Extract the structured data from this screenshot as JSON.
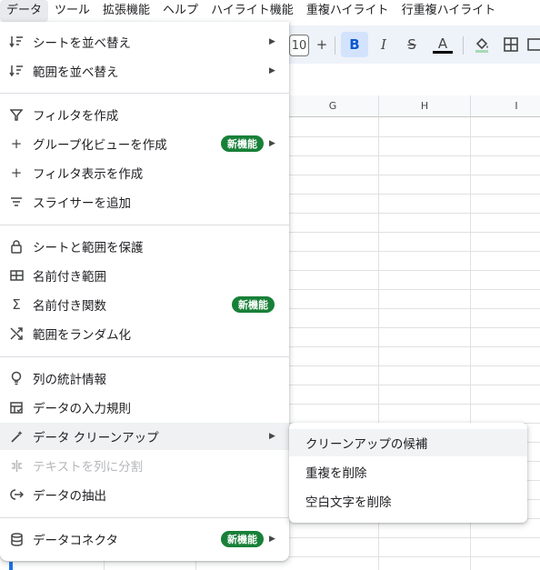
{
  "menubar": {
    "items": [
      "データ",
      "ツール",
      "拡張機能",
      "ヘルプ",
      "ハイライト機能",
      "重複ハイライト",
      "行重複ハイライト"
    ]
  },
  "toolbar": {
    "font_size": "10",
    "plus": "+",
    "bold": "B",
    "italic": "I",
    "strike": "S",
    "text_color": "A"
  },
  "columns": [
    "G",
    "H",
    "I"
  ],
  "menu": {
    "items": [
      {
        "label": "シートを並べ替え",
        "icon": "sort-icon",
        "submenu": true
      },
      {
        "label": "範囲を並べ替え",
        "icon": "sort-icon",
        "submenu": true
      },
      {
        "label": "フィルタを作成",
        "icon": "filter-icon"
      },
      {
        "label": "グループ化ビューを作成",
        "icon": "plus-icon",
        "badge": "新機能",
        "submenu": true
      },
      {
        "label": "フィルタ表示を作成",
        "icon": "plus-icon"
      },
      {
        "label": "スライサーを追加",
        "icon": "slicer-icon"
      },
      {
        "label": "シートと範囲を保護",
        "icon": "lock-icon"
      },
      {
        "label": "名前付き範囲",
        "icon": "table-icon"
      },
      {
        "label": "名前付き関数",
        "icon": "sigma-icon",
        "badge": "新機能"
      },
      {
        "label": "範囲をランダム化",
        "icon": "shuffle-icon"
      },
      {
        "label": "列の統計情報",
        "icon": "lightbulb-icon"
      },
      {
        "label": "データの入力規則",
        "icon": "validation-icon"
      },
      {
        "label": "データ クリーンアップ",
        "icon": "magic-wand-icon",
        "submenu": true
      },
      {
        "label": "テキストを列に分割",
        "icon": "split-icon"
      },
      {
        "label": "データの抽出",
        "icon": "extract-icon"
      },
      {
        "label": "データコネクタ",
        "icon": "database-icon",
        "badge": "新機能",
        "submenu": true
      }
    ]
  },
  "submenu": {
    "items": [
      "クリーンアップの候補",
      "重複を削除",
      "空白文字を削除"
    ]
  },
  "colors": {
    "badge": "#188038",
    "highlight": "#eff1f3",
    "toolbar": "#eef2f9",
    "bold_active": "#d3e3fd"
  }
}
